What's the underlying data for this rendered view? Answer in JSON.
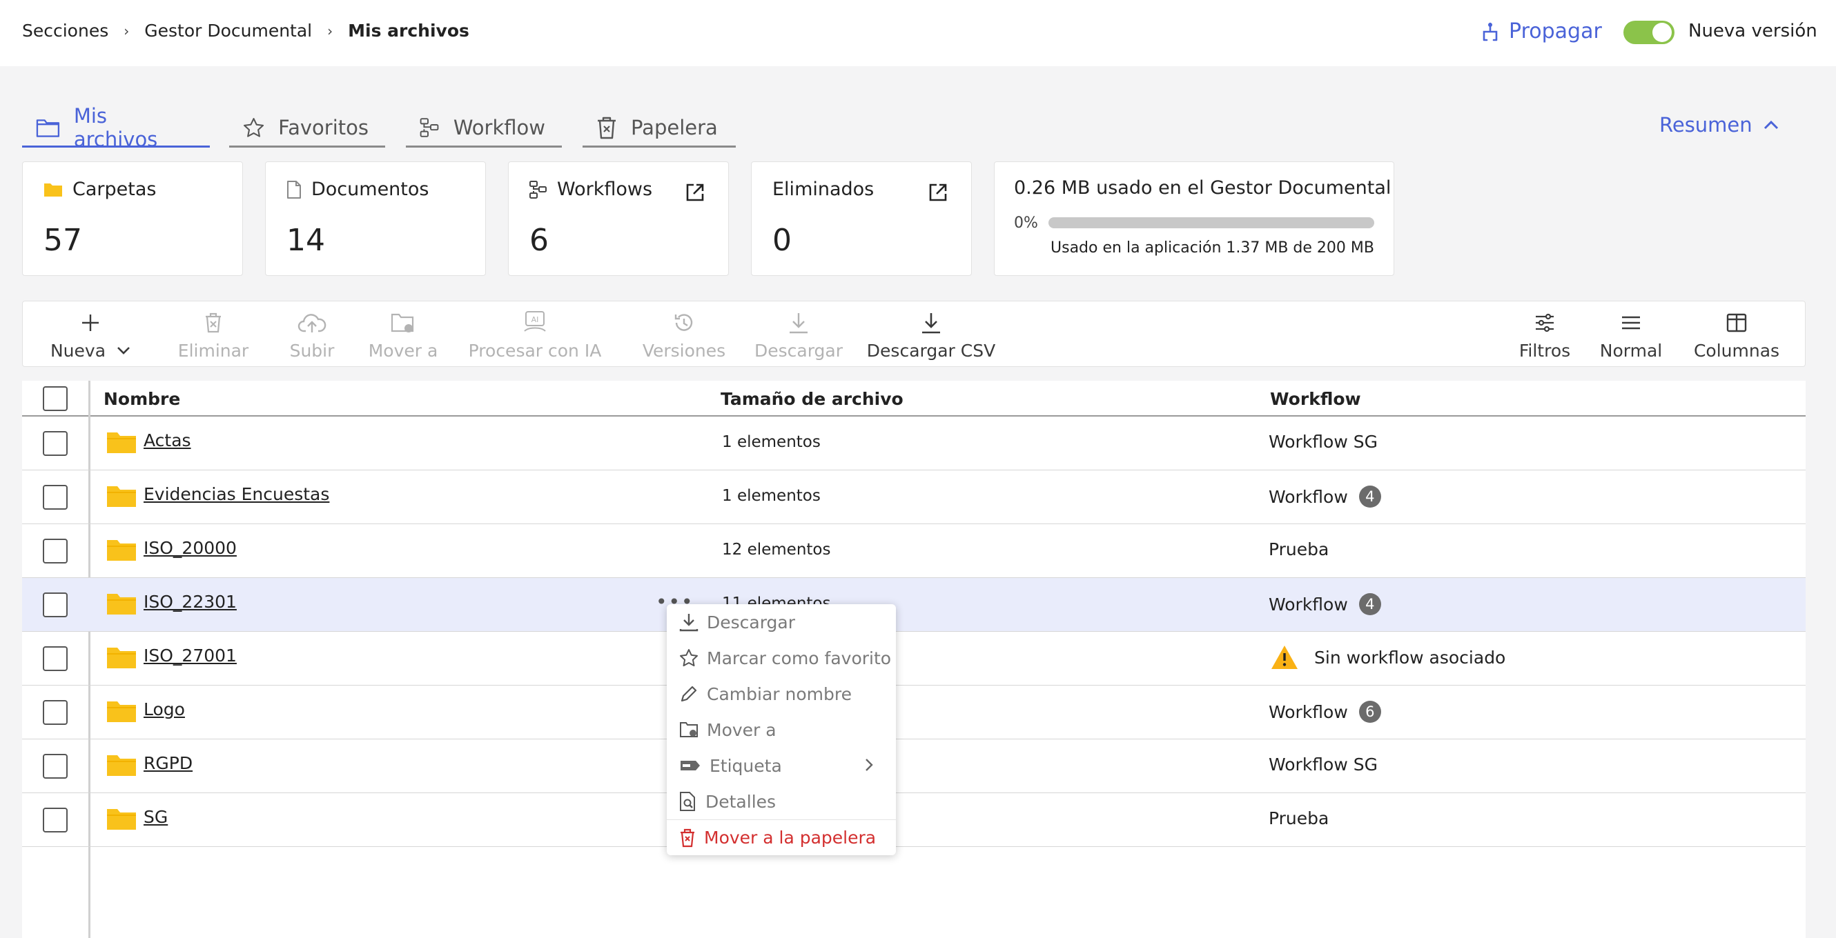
{
  "breadcrumb": {
    "item1": "Secciones",
    "item2": "Gestor Documental",
    "current": "Mis archivos"
  },
  "header": {
    "propagar": "Propagar",
    "nueva_version": "Nueva versión",
    "toggle_on": true
  },
  "tabs": [
    {
      "label": "Mis archivos",
      "icon": "folder-icon",
      "active": true
    },
    {
      "label": "Favoritos",
      "icon": "star-icon"
    },
    {
      "label": "Workflow",
      "icon": "workflow-icon"
    },
    {
      "label": "Papelera",
      "icon": "trash-icon"
    }
  ],
  "resumen": "Resumen",
  "stats": {
    "carpetas": {
      "label": "Carpetas",
      "value": "57"
    },
    "documentos": {
      "label": "Documentos",
      "value": "14"
    },
    "workflows": {
      "label": "Workflows",
      "value": "6"
    },
    "eliminados": {
      "label": "Eliminados",
      "value": "0"
    }
  },
  "usage": {
    "title": "0.26 MB usado en el Gestor Documental",
    "percent_label": "0%",
    "percent": 0,
    "subtitle": "Usado en la aplicación 1.37 MB de 200 MB"
  },
  "toolbar": {
    "nueva": "Nueva",
    "eliminar": "Eliminar",
    "subir": "Subir",
    "mover_a": "Mover a",
    "procesar_ia": "Procesar con IA",
    "versiones": "Versiones",
    "descargar": "Descargar",
    "descargar_csv": "Descargar CSV",
    "filtros": "Filtros",
    "normal": "Normal",
    "columnas": "Columnas"
  },
  "table": {
    "headers": {
      "nombre": "Nombre",
      "tamano": "Tamaño de archivo",
      "workflow": "Workflow"
    },
    "rows": [
      {
        "name": "Actas",
        "size": "1 elementos",
        "workflow": "Workflow SG",
        "badge": ""
      },
      {
        "name": "Evidencias Encuestas",
        "size": "1 elementos",
        "workflow": "Workflow",
        "badge": "4"
      },
      {
        "name": "ISO_20000",
        "size": "12 elementos",
        "workflow": "Prueba",
        "badge": ""
      },
      {
        "name": "ISO_22301",
        "size": "11 elementos",
        "workflow": "Workflow",
        "badge": "4"
      },
      {
        "name": "ISO_27001",
        "size": "",
        "workflow": "Sin workflow asociado",
        "badge": ""
      },
      {
        "name": "Logo",
        "size": "",
        "workflow": "Workflow",
        "badge": "6"
      },
      {
        "name": "RGPD",
        "size": "",
        "workflow": "Workflow SG",
        "badge": ""
      },
      {
        "name": "SG",
        "size": "",
        "workflow": "Prueba",
        "badge": ""
      }
    ]
  },
  "context_menu": {
    "descargar": "Descargar",
    "favorito": "Marcar como favorito",
    "cambiar_nombre": "Cambiar nombre",
    "mover_a": "Mover a",
    "etiqueta": "Etiqueta",
    "detalles": "Detalles",
    "papelera": "Mover a la papelera"
  },
  "colors": {
    "accent": "#4a63d8",
    "toggle": "#8bc34a",
    "folder": "#f9c21b",
    "danger": "#d32f2f",
    "row_highlight": "#e9ecfb"
  }
}
